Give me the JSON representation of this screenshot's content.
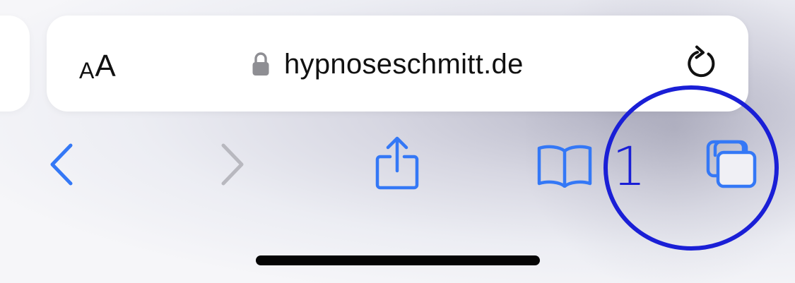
{
  "address_bar": {
    "text_size_small": "A",
    "text_size_large": "A",
    "url": "hypnoseschmitt.de"
  },
  "toolbar": {
    "back_icon": "chevron-left-icon",
    "forward_icon": "chevron-right-icon",
    "share_icon": "share-icon",
    "bookmarks_icon": "book-icon",
    "tabs_icon": "tabs-icon"
  },
  "annotation": {
    "number": "1",
    "color": "#1a1fd6"
  },
  "colors": {
    "accent": "#3478f6",
    "disabled": "#b8b8bf",
    "text": "#111111"
  }
}
